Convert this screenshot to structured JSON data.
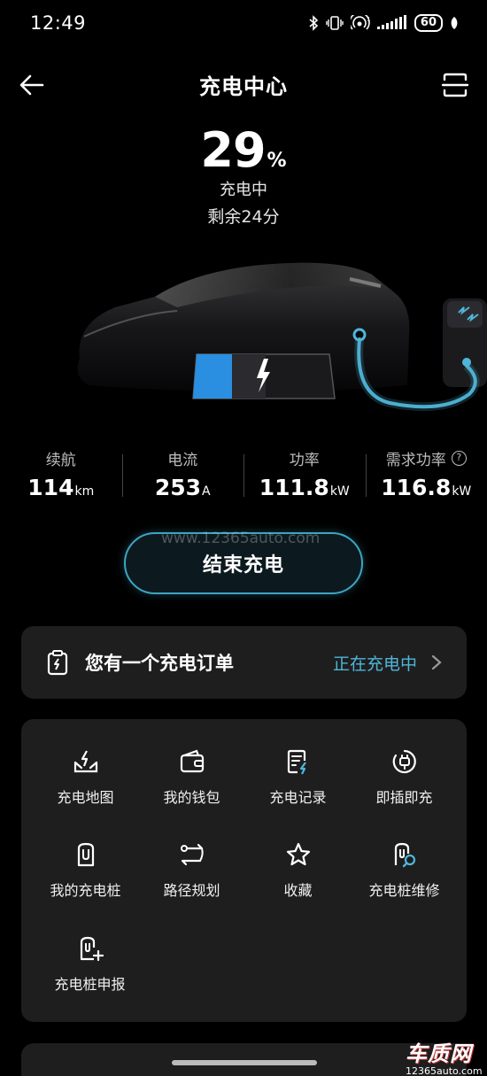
{
  "status_bar": {
    "time": "12:49",
    "battery": "60",
    "network": "1"
  },
  "header": {
    "title": "充电中心"
  },
  "charge": {
    "percent": "29",
    "percent_unit": "%",
    "status": "充电中",
    "remaining": "剩余24分",
    "level": 0.29
  },
  "stats": [
    {
      "label": "续航",
      "value": "114",
      "unit": "km"
    },
    {
      "label": "电流",
      "value": "253",
      "unit": "A"
    },
    {
      "label": "功率",
      "value": "111.8",
      "unit": "kW"
    },
    {
      "label": "需求功率",
      "value": "116.8",
      "unit": "kW",
      "help": "?"
    }
  ],
  "end_button": {
    "label": "结束充电"
  },
  "watermark_url": "www.12365auto.com",
  "order": {
    "text": "您有一个充电订单",
    "status": "正在充电中"
  },
  "features": [
    {
      "label": "充电地图",
      "icon": "charging-map-icon"
    },
    {
      "label": "我的钱包",
      "icon": "wallet-icon"
    },
    {
      "label": "充电记录",
      "icon": "charging-record-icon"
    },
    {
      "label": "即插即充",
      "icon": "plug-and-charge-icon"
    },
    {
      "label": "我的充电桩",
      "icon": "my-charger-icon"
    },
    {
      "label": "路径规划",
      "icon": "route-planning-icon"
    },
    {
      "label": "收藏",
      "icon": "favorite-star-icon"
    },
    {
      "label": "充电桩维修",
      "icon": "charger-repair-icon"
    },
    {
      "label": "充电桩申报",
      "icon": "charger-report-icon"
    }
  ],
  "logo": {
    "text": "车质网",
    "sub": "12365auto.com"
  },
  "colors": {
    "accent": "#4fb6d9",
    "battery_fill": "#2a8fe0",
    "card_bg": "#1e1e1f"
  }
}
